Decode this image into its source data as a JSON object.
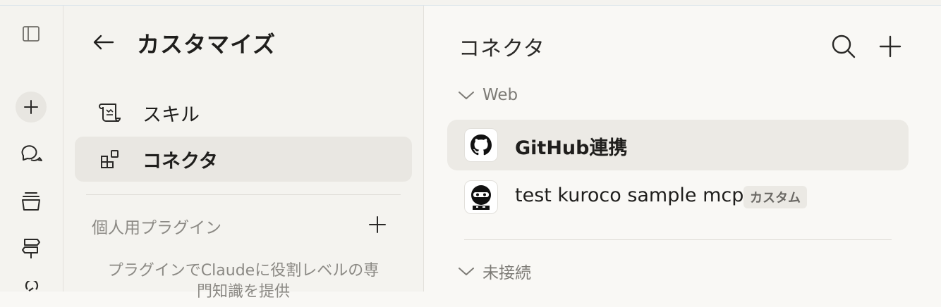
{
  "rail": {
    "items": [
      "sidebar-toggle",
      "new-chat",
      "chats",
      "projects",
      "artifacts",
      "code"
    ]
  },
  "customize": {
    "title": "カスタマイズ",
    "nav": [
      {
        "label": "スキル",
        "icon": "skills-scroll-icon"
      },
      {
        "label": "コネクタ",
        "icon": "connectors-blocks-icon"
      }
    ],
    "plugins_label": "個人用プラグイン",
    "plugins_hint_line1": "プラグインでClaudeに役割レベルの専",
    "plugins_hint_line2": "門知識を提供"
  },
  "connectors": {
    "title": "コネクタ",
    "groups": [
      {
        "label": "Web"
      },
      {
        "label": "未接続"
      }
    ],
    "items": [
      {
        "name": "GitHub連携",
        "icon": "github-icon",
        "selected": true
      },
      {
        "name": "test kuroco sample mcp",
        "badge": "カスタム",
        "icon": "kuroco-ninja-icon",
        "selected": false
      }
    ]
  },
  "colors": {
    "background": "#f9f8f5",
    "sidebar": "#f4f3ef",
    "selected": "#eceae5"
  }
}
